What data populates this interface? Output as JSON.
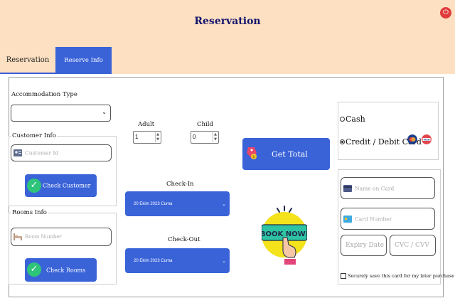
{
  "header": {
    "title": "Reservation",
    "power_icon": "power-icon"
  },
  "tabs": [
    {
      "label": "Reservation",
      "active": true
    },
    {
      "label": "Reserve Info",
      "active": false
    }
  ],
  "accommodation": {
    "label": "Accommodation Type",
    "value": ""
  },
  "customer": {
    "legend": "Customer Info",
    "id_placeholder": "Customer Id",
    "check_button": "Check Customer"
  },
  "rooms": {
    "legend": "Rooms Info",
    "number_placeholder": "Room Number",
    "check_button": "Check Rooms"
  },
  "guests": {
    "adult_label": "Adult",
    "adult_value": "1",
    "child_label": "Child",
    "child_value": "0"
  },
  "checkin": {
    "label": "Check-In",
    "value": "20 Ekim 2023 Cuma"
  },
  "checkout": {
    "label": "Check-Out",
    "value": "20 Ekim 2023 Cuma"
  },
  "total": {
    "button": "Get Total"
  },
  "book_now": {
    "text": "BOOK NOW!"
  },
  "payment": {
    "cash_label": "Cash",
    "card_label": "Credit / Debit Card",
    "selected": "card",
    "card_brands": [
      "Mastercard",
      "VISA"
    ]
  },
  "card_form": {
    "name_placeholder": "Name on Card",
    "number_placeholder": "Card Number",
    "expiry_placeholder": "Expiry Date",
    "cvc_placeholder": "CVC / CVV",
    "save_label": "Securely save this card for my later purchase",
    "save_checked": false
  },
  "colors": {
    "header_bg": "#fde0c1",
    "accent": "#3a63d8",
    "success": "#2ec47a",
    "title": "#14146e"
  }
}
